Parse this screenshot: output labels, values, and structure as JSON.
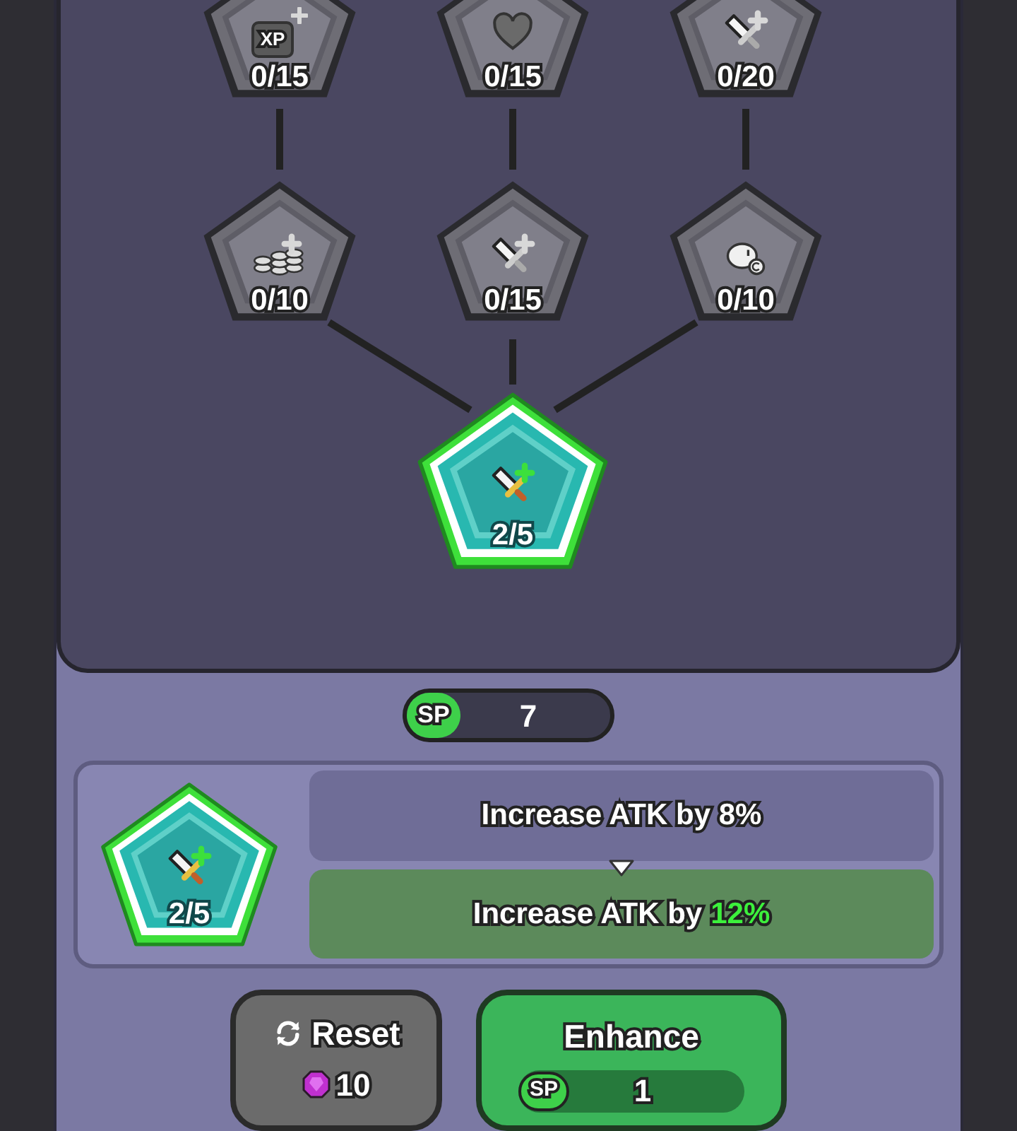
{
  "tree": {
    "root": {
      "kind": "sword",
      "progress": "2/5",
      "selected": true,
      "children": [
        {
          "kind": "coins",
          "progress": "0/10",
          "selected": false,
          "children": [
            {
              "kind": "xp",
              "badge": "XP",
              "progress": "0/15",
              "selected": false
            }
          ]
        },
        {
          "kind": "sword",
          "progress": "0/15",
          "selected": false,
          "children": [
            {
              "kind": "heart",
              "progress": "0/15",
              "selected": false
            }
          ]
        },
        {
          "kind": "creature",
          "progress": "0/10",
          "selected": false,
          "children": [
            {
              "kind": "sword",
              "progress": "0/20",
              "selected": false
            }
          ]
        }
      ]
    }
  },
  "sp_counter": {
    "label": "SP",
    "value": "7"
  },
  "detail": {
    "kind": "sword",
    "progress": "2/5",
    "current": "Increase ATK by 8%",
    "next_prefix": "Increase ATK by",
    "next_value": "12%"
  },
  "buttons": [
    {
      "kind": "reset",
      "label": "Reset",
      "cost": "10"
    },
    {
      "kind": "enhance",
      "label": "Enhance",
      "cost_label": "SP",
      "cost": "1"
    }
  ]
}
